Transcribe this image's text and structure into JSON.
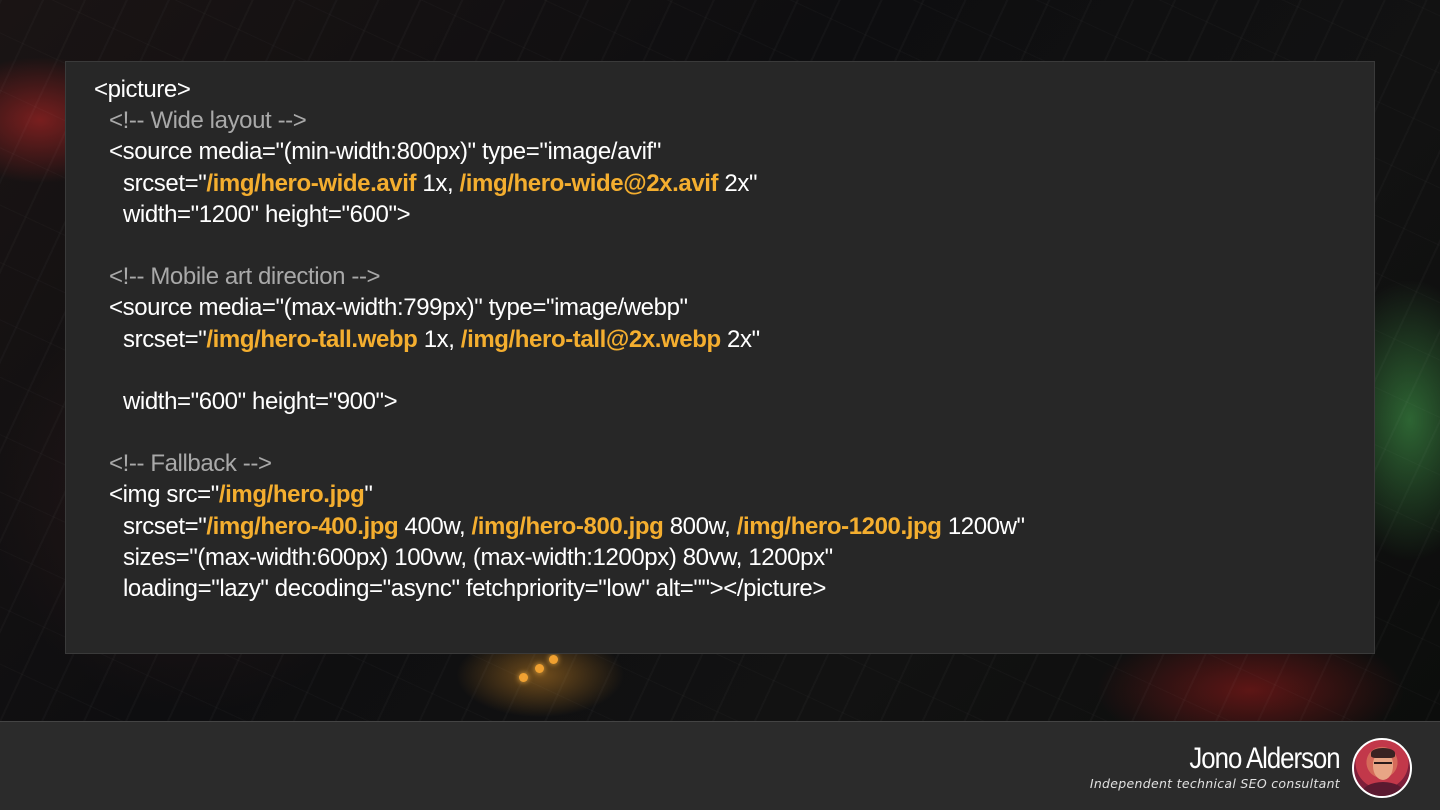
{
  "code": {
    "l1": "<picture>",
    "l2": "<!-- Wide layout -->",
    "l3": "<source media=\"(min-width:800px)\" type=\"image/avif\"",
    "l4_pre": "srcset=\"",
    "l4_url1": "/img/hero-wide.avif",
    "l4_mid": " 1x, ",
    "l4_url2": "/img/hero-wide@2x.avif",
    "l4_post": " 2x\"",
    "l5": "width=\"1200\" height=\"600\">",
    "l7": "<!-- Mobile art direction -->",
    "l8": "<source media=\"(max-width:799px)\" type=\"image/webp\"",
    "l9_pre": "srcset=\"",
    "l9_url1": "/img/hero-tall.webp",
    "l9_mid": " 1x, ",
    "l9_url2": "/img/hero-tall@2x.webp",
    "l9_post": " 2x\"",
    "l11": "width=\"600\" height=\"900\">",
    "l13": "<!-- Fallback -->",
    "l14_pre": "<img src=\"",
    "l14_url": "/img/hero.jpg",
    "l14_post": "\"",
    "l15_pre": "srcset=\"",
    "l15_url1": "/img/hero-400.jpg",
    "l15_mid1": " 400w, ",
    "l15_url2": "/img/hero-800.jpg",
    "l15_mid2": " 800w, ",
    "l15_url3": "/img/hero-1200.jpg",
    "l15_post": " 1200w\"",
    "l16": "sizes=\"(max-width:600px) 100vw, (max-width:1200px) 80vw, 1200px\"",
    "l17": "loading=\"lazy\" decoding=\"async\" fetchpriority=\"low\" alt=\"\"></picture>"
  },
  "footer": {
    "author_name": "Jono Alderson",
    "author_subtitle": "Independent technical SEO consultant"
  },
  "colors": {
    "highlight": "#f4ae2f",
    "comment": "#a9a9a9",
    "panel": "#272727"
  }
}
